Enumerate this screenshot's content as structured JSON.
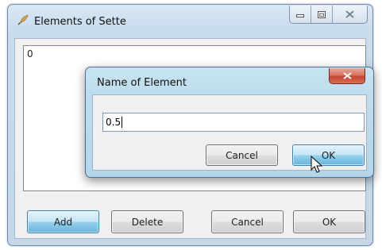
{
  "main_window": {
    "title": "Elements of Sette",
    "list_items": [
      "0"
    ],
    "buttons": {
      "add": "Add",
      "delete": "Delete",
      "cancel": "Cancel",
      "ok": "OK"
    }
  },
  "dialog": {
    "title": "Name of Element",
    "input_value": "0.5",
    "buttons": {
      "cancel": "Cancel",
      "ok": "OK"
    }
  },
  "icons": {
    "app": "feather-pen-icon",
    "minimize": "minimize-icon",
    "maximize": "maximize-icon",
    "close": "close-icon",
    "cursor": "mouse-pointer-icon"
  },
  "colors": {
    "window_frame": "#c9dcee",
    "dialog_frame": "#bfdded",
    "default_button": "#98d1ef",
    "close_button": "#c54530"
  }
}
